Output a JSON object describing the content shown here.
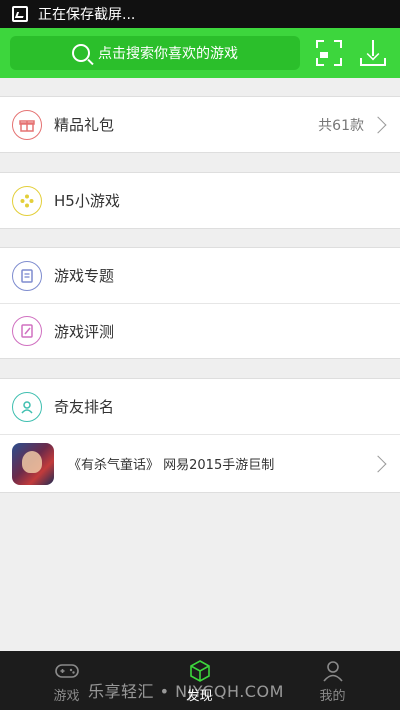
{
  "status_bar": {
    "text": "正在保存截屏..."
  },
  "topbar": {
    "search_placeholder": "点击搜索你喜欢的游戏",
    "scan_icon": "scan-icon",
    "download_icon": "download-icon"
  },
  "sections": {
    "gift": {
      "label": "精品礼包",
      "count": "共61款",
      "icon_color": "#e57373"
    },
    "h5": {
      "label": "H5小游戏",
      "icon_color": "#e3cf3a"
    },
    "topic": {
      "label": "游戏专题",
      "icon_color": "#7e8ccf"
    },
    "review": {
      "label": "游戏评测",
      "icon_color": "#d070c0"
    },
    "rank": {
      "label": "奇友排名",
      "icon_color": "#3fbfb0"
    },
    "promo": {
      "text": "《有杀气童话》 网易2015手游巨制"
    }
  },
  "bottom_tabs": [
    {
      "label": "游戏",
      "icon": "gamepad-icon"
    },
    {
      "label": "发现",
      "icon": "discover-cube-icon",
      "active": true
    },
    {
      "label": "我的",
      "icon": "user-icon"
    }
  ],
  "watermark": "乐享轻汇 • NJYCQH.COM",
  "colors": {
    "accent": "#3dd63d",
    "search_bg": "#2bbf2b"
  }
}
